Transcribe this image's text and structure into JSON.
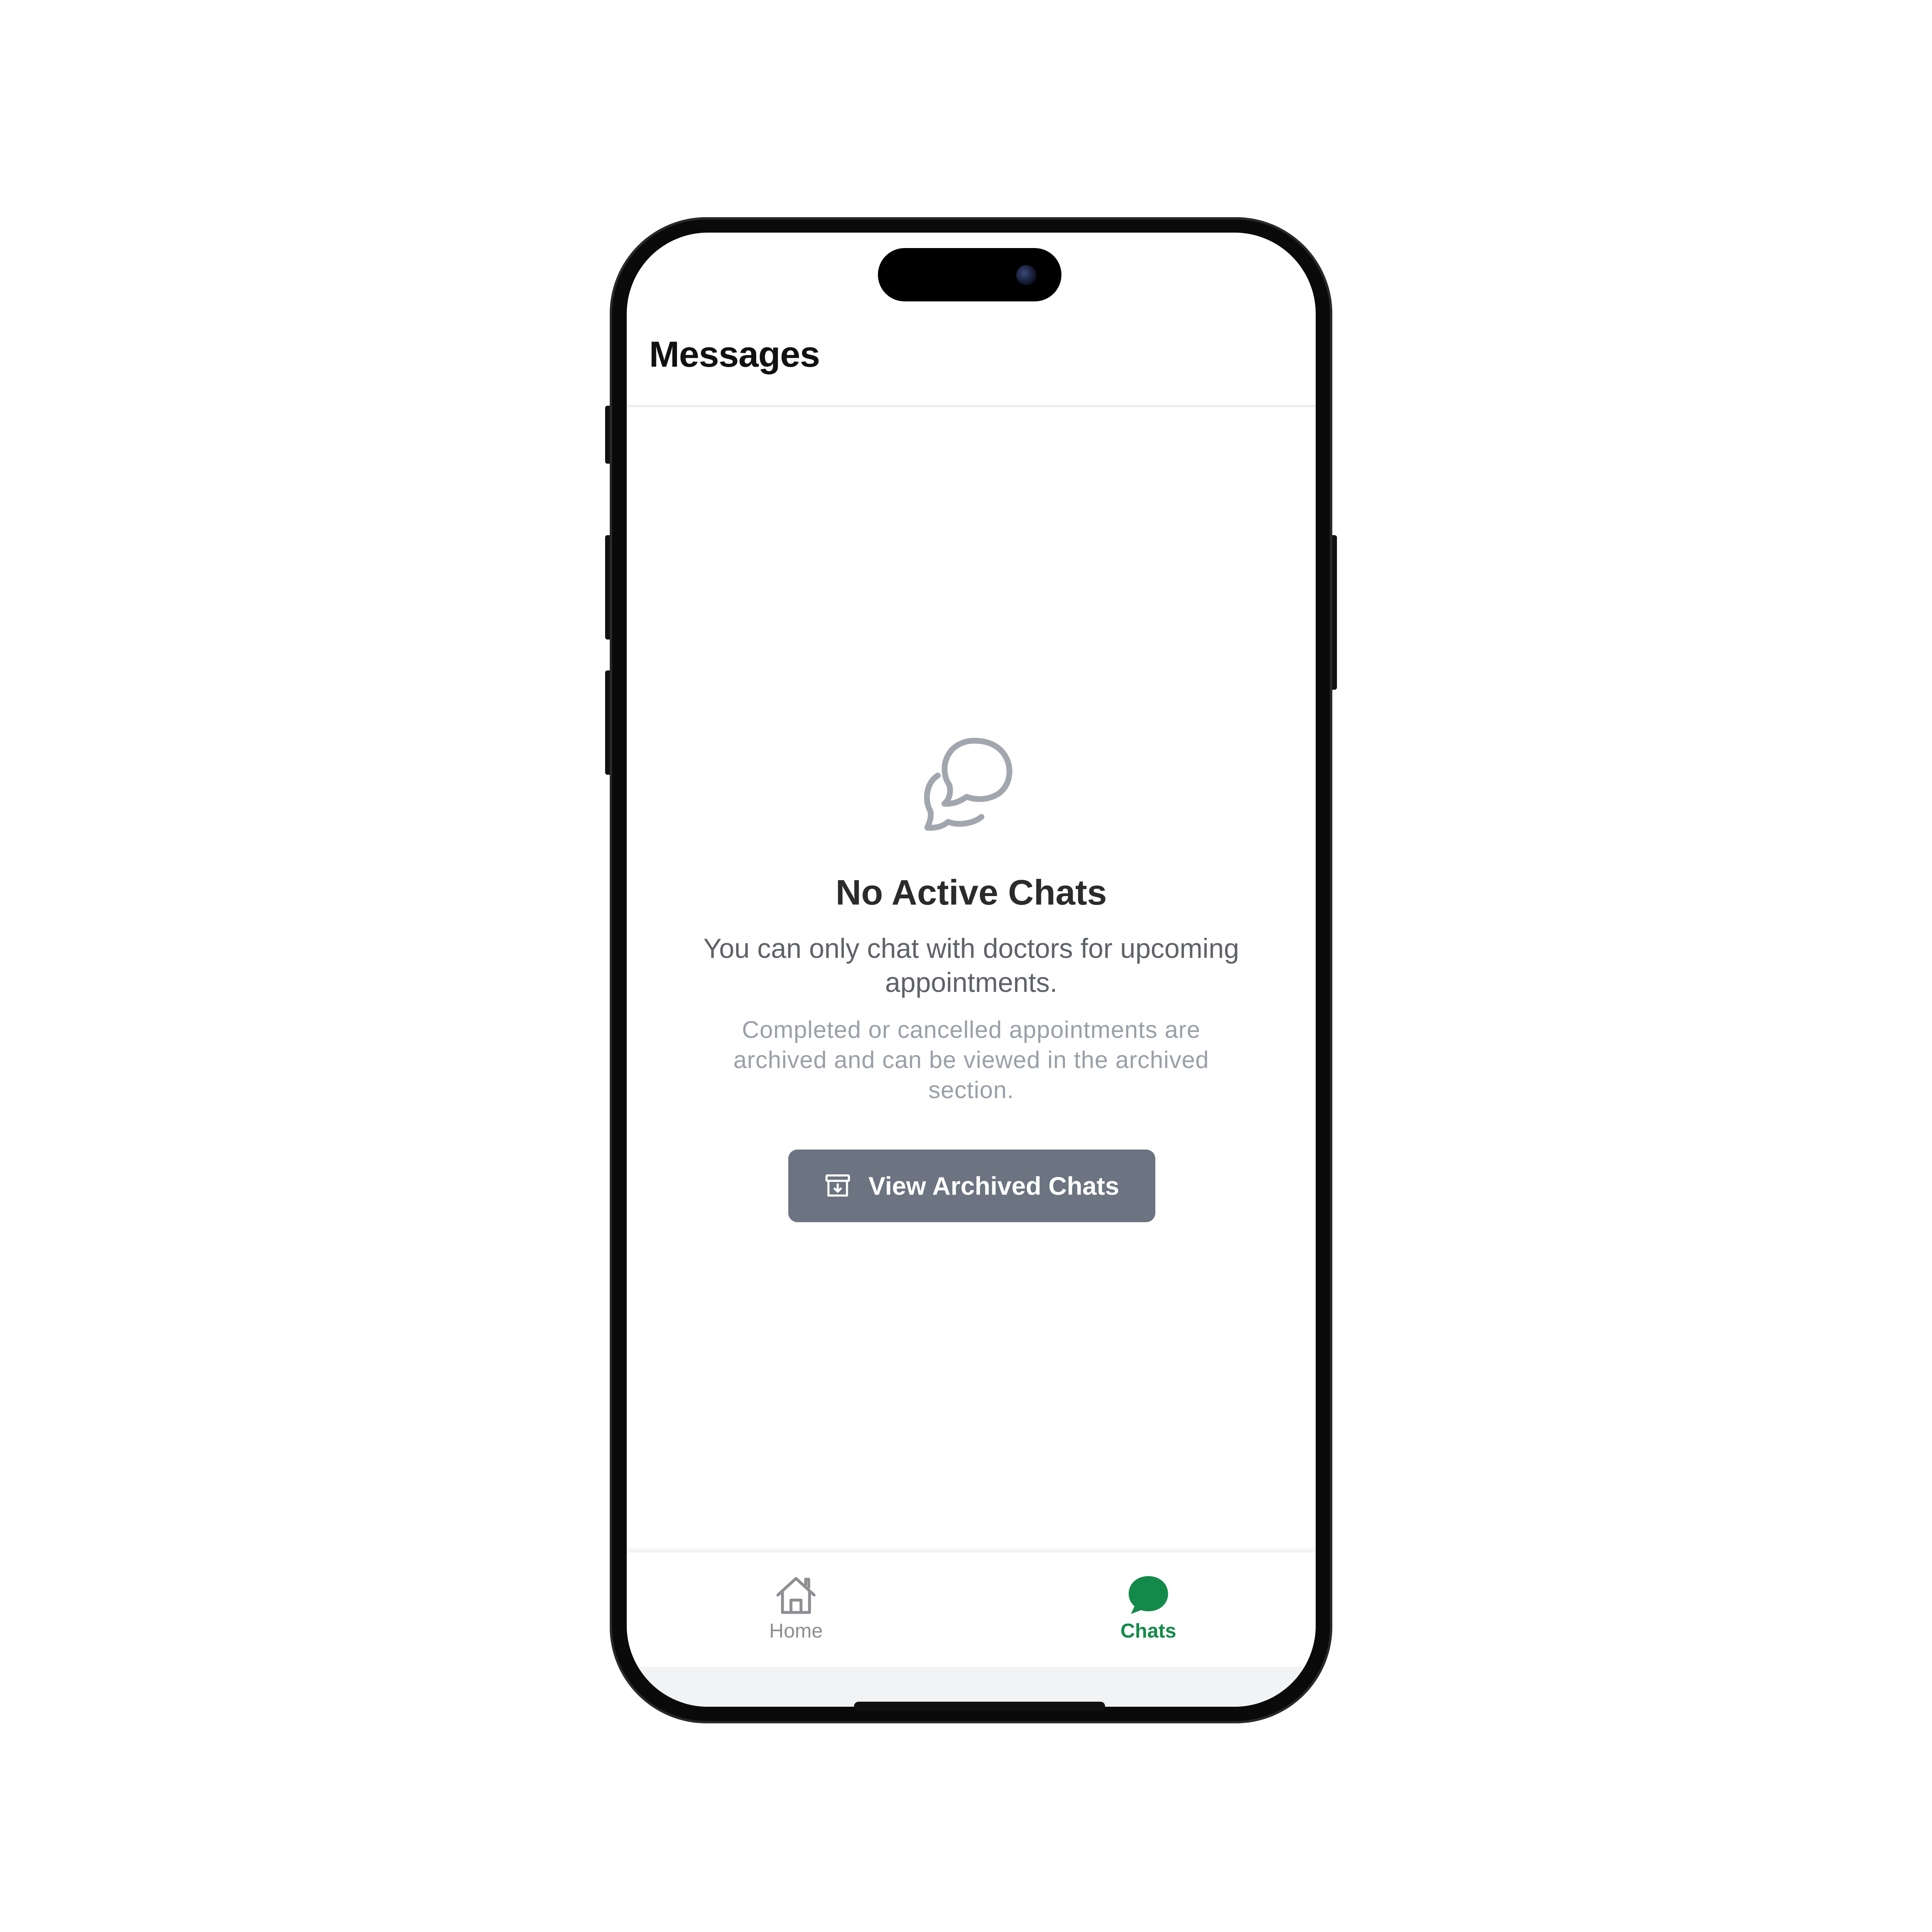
{
  "header": {
    "title": "Messages"
  },
  "empty_state": {
    "icon": "chat-bubbles-icon",
    "title": "No Active Chats",
    "subtitle": "You can only chat with doctors for upcoming appointments.",
    "note": "Completed or cancelled appointments are archived and can be viewed in the archived section.",
    "button_label": "View Archived Chats",
    "button_icon": "archive-icon"
  },
  "tabs": [
    {
      "label": "Home",
      "icon": "home-icon",
      "active": false
    },
    {
      "label": "Chats",
      "icon": "chat-icon",
      "active": true
    }
  ],
  "colors": {
    "accent": "#148a4a",
    "button": "#6b7480",
    "muted_icon": "#a2a6ae"
  }
}
